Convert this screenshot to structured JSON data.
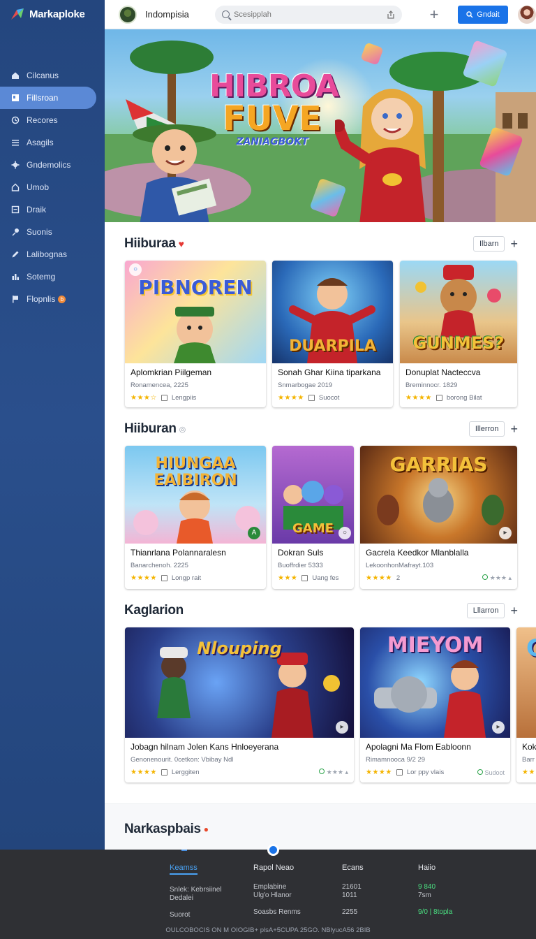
{
  "brand": {
    "name": "Markaploke"
  },
  "sidebar": {
    "items": [
      {
        "label": "Cilcanus",
        "icon": "home-icon"
      },
      {
        "label": "Fillsroan",
        "icon": "bookmark-icon",
        "active": true
      },
      {
        "label": "Recores",
        "icon": "clock-icon"
      },
      {
        "label": "Asagils",
        "icon": "list-icon"
      },
      {
        "label": "Gndemolics",
        "icon": "gear-icon"
      },
      {
        "label": "Umob",
        "icon": "house-icon"
      },
      {
        "label": "Draik",
        "icon": "box-icon"
      },
      {
        "label": "Suonis",
        "icon": "pin-icon"
      },
      {
        "label": "Lalibognas",
        "icon": "pencil-icon"
      },
      {
        "label": "Sotemg",
        "icon": "chart-icon"
      },
      {
        "label": "Flopnlis",
        "icon": "flag-icon",
        "badge": "b"
      }
    ]
  },
  "header": {
    "title": "Indompisia",
    "search_placeholder": "Scesipplah",
    "primary_button": "Gndait"
  },
  "hero": {
    "line1": "HIBROA",
    "line2": "FUVE",
    "line3": "ZANIAGBOKT"
  },
  "sections": [
    {
      "title": "Hiiburaa",
      "title_icon": "heart-icon",
      "button": "Ilbarn",
      "cards": [
        {
          "art_text": "PIBNOREN",
          "title": "Aplomkrian Piilgeman",
          "sub": "Ronamencea, 2225",
          "stars": "★★★☆",
          "meta": "Lengpiis"
        },
        {
          "art_text": "DUARPILA",
          "title": "Sonah Ghar Kiina tiparkana",
          "sub": "Snmarbogae 2019",
          "stars": "★★★★",
          "meta": "Suocot"
        },
        {
          "art_text": "GUNMES?",
          "title": "Donuplat Nacteccva",
          "sub": "Breminnocr. 1829",
          "stars": "★★★★",
          "meta": "borong Bilat"
        }
      ]
    },
    {
      "title": "Hiiburan",
      "title_icon": "info-icon",
      "button": "Illerron",
      "cards": [
        {
          "art_text": "HIUNGAA EAIBIRON",
          "title": "Thianrlana Polannaralesn",
          "sub": "Banarchenoh. 2225",
          "stars": "★★★★",
          "meta": "Longp rait"
        },
        {
          "art_text": "GAME",
          "title": "Dokran Suls",
          "sub": "Buoffrdier 5333",
          "stars": "★★★",
          "meta": "Uang fes"
        },
        {
          "art_text": "GARRIAS",
          "title": "Gacrela Keedkor Mlanblalla",
          "sub": "LekoonhonMafrayt.103",
          "stars": "★★★★",
          "meta": "2"
        }
      ]
    },
    {
      "title": "Kaglarion",
      "button": "Lllarron",
      "cards": [
        {
          "art_text": "Nlouping",
          "title": "Jobagn hilnam Jolen Kans Hnloeyerana",
          "sub": "Genonenourit. 0cetkon: Vbibay Ndl",
          "stars": "★★★★",
          "meta": "Lerggiten"
        },
        {
          "art_text": "MIEYOM",
          "title": "Apolagni Ma Flom Eabloonn",
          "sub": "Rimamnooca 9/2 29",
          "stars": "★★★★",
          "meta": "Lor ppy vlais",
          "extra": "Sudoot"
        },
        {
          "art_text": "G",
          "title": "Kok",
          "sub": "Barr",
          "stars": "★★",
          "meta": ""
        }
      ]
    },
    {
      "title": "Narkaspbais",
      "title_icon": "fire-icon"
    }
  ],
  "footer": {
    "cols": [
      {
        "head": "Keamss",
        "rows": [
          "Snlek: Kebrsiinel",
          "Dedalei",
          "",
          "Suorot"
        ]
      },
      {
        "head": "Rapol Neao",
        "rows": [
          "Emplabine",
          "Ulg'o Hlanor",
          "",
          "Soasbs Renms"
        ]
      },
      {
        "head": "Ecans",
        "rows": [
          "21601",
          "1011",
          "",
          "2255"
        ]
      },
      {
        "head": "Haiio",
        "rows": [
          "9 840",
          "7sm",
          "",
          "9/0 | 8topla"
        ]
      }
    ],
    "copyright": "OULCOBOCIS ON M OIOGIB+ plsA+5CUPA 25GO. NBlyucA56 2BIB"
  }
}
